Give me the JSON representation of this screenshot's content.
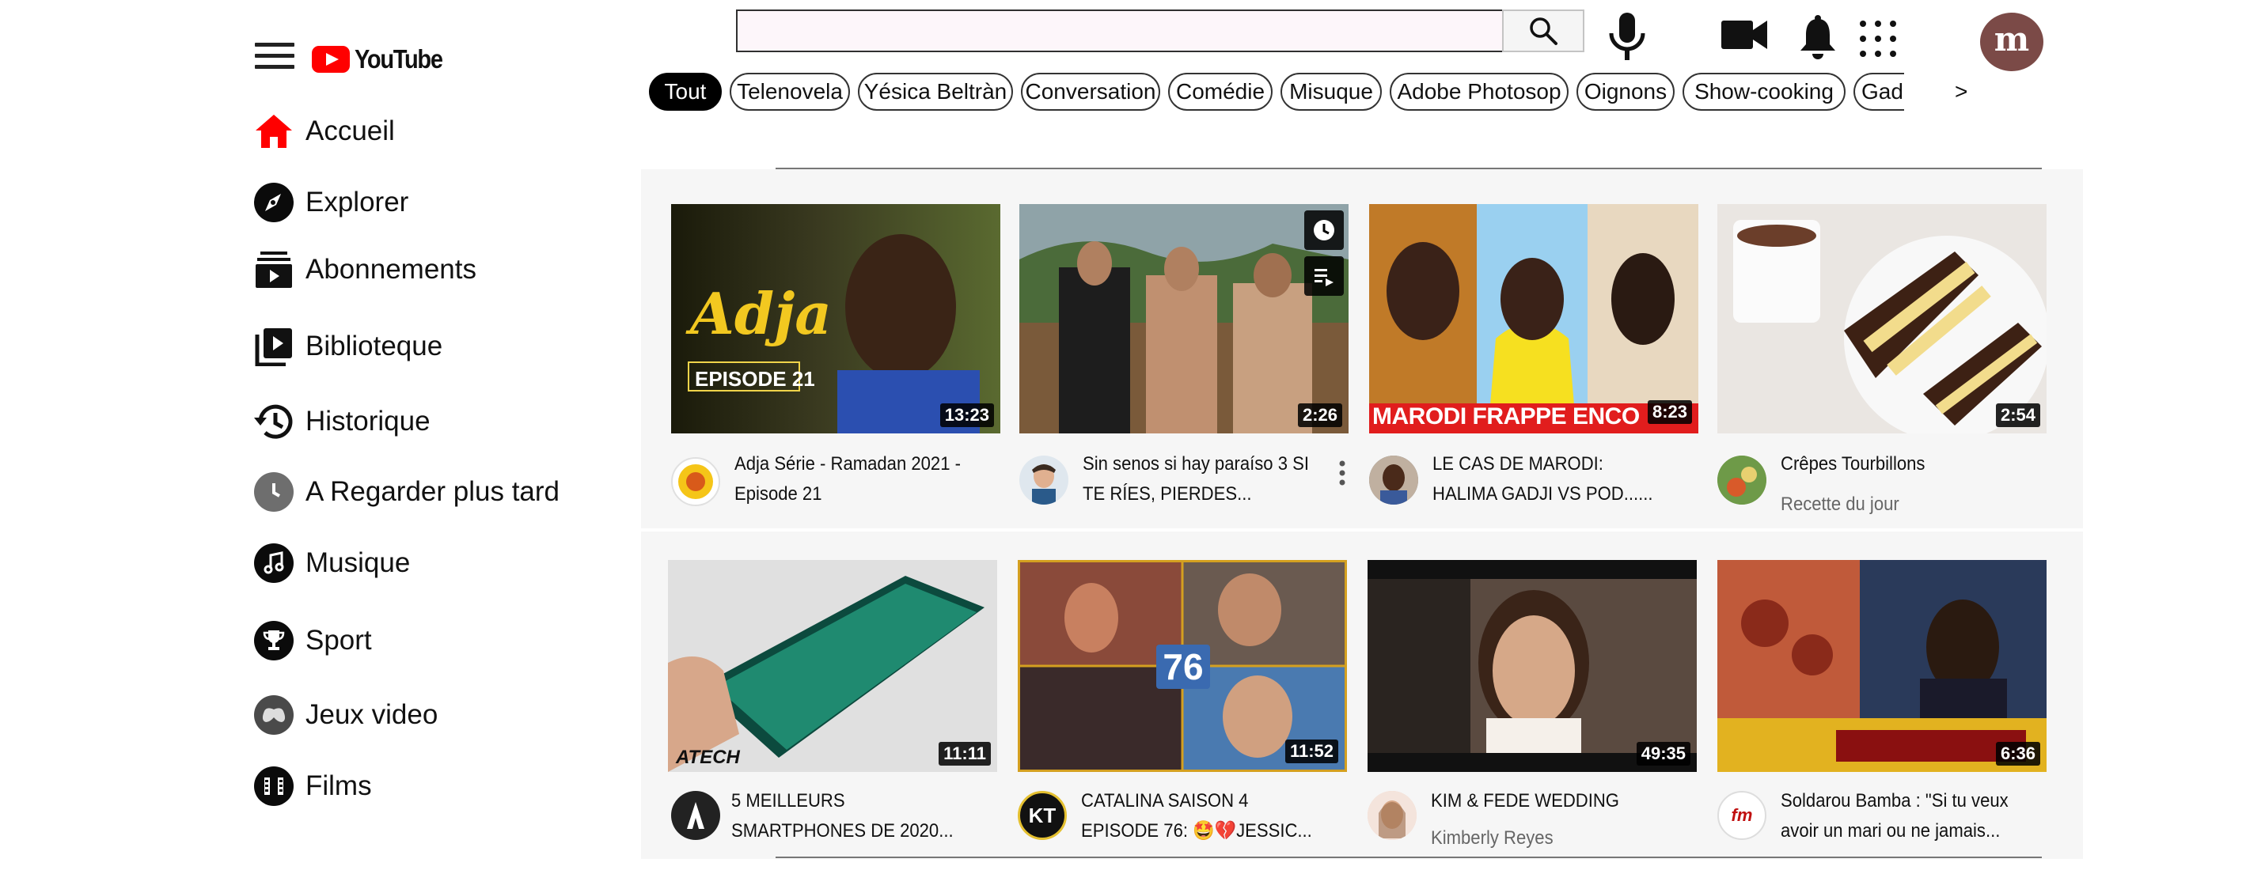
{
  "header": {
    "logo_text": "YouTube",
    "search": {
      "value": "",
      "placeholder": ""
    },
    "avatar_letter": "m"
  },
  "chips": [
    "Tout",
    "Telenovela",
    "Yésica Beltràn",
    "Conversation",
    "Comédie",
    "Misuque",
    "Adobe Photosop",
    "Oignons",
    "Show-cooking",
    "Gad"
  ],
  "chips_next": ">",
  "sidebar": {
    "items": [
      {
        "label": "Accueil",
        "icon": "home-icon"
      },
      {
        "label": "Explorer",
        "icon": "compass-icon"
      },
      {
        "label": "Abonnements",
        "icon": "subscriptions-icon"
      },
      {
        "label": "Biblioteque",
        "icon": "library-icon"
      },
      {
        "label": "Historique",
        "icon": "history-icon"
      },
      {
        "label": "A Regarder plus tard",
        "icon": "clock-icon"
      },
      {
        "label": "Musique",
        "icon": "music-icon"
      },
      {
        "label": "Sport",
        "icon": "trophy-icon"
      },
      {
        "label": "Jeux video",
        "icon": "gamepad-icon"
      },
      {
        "label": "Films",
        "icon": "film-icon"
      }
    ]
  },
  "videos": [
    {
      "title": "Adja Série - Ramadan 2021 - Episode 21",
      "channel": "",
      "duration": "13:23",
      "thumb_text": "Adja",
      "thumb_subtext": "EPISODE 21"
    },
    {
      "title": "Sin senos si hay paraíso 3 SI TE RÍES, PIERDES...",
      "channel": "",
      "duration": "2:26"
    },
    {
      "title": "LE CAS DE MARODI: HALIMA GADJI VS POD......",
      "channel": "",
      "duration": "8:23",
      "thumb_text": "MARODI FRAPPE ENCO"
    },
    {
      "title": "Crêpes Tourbillons",
      "channel": "Recette du jour",
      "duration": "2:54"
    },
    {
      "title": "5 MEILLEURS SMARTPHONES DE 2020...",
      "channel": "",
      "duration": "11:11",
      "thumb_text": "ATECH"
    },
    {
      "title": "CATALINA SAISON 4 EPISODE 76: 🤩💔JESSIC...",
      "channel": "",
      "duration": "11:52",
      "thumb_text": "76",
      "channel_avatar_text": "KT"
    },
    {
      "title": "KIM & FEDE WEDDING",
      "channel": "Kimberly Reyes",
      "duration": "49:35"
    },
    {
      "title": "Soldarou Bamba : \"Si tu veux avoir un mari ou ne jamais...",
      "channel": "",
      "duration": "6:36",
      "channel_avatar_text": "fm"
    }
  ]
}
